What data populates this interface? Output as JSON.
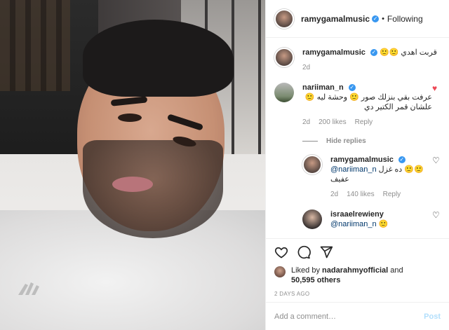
{
  "header": {
    "username": "ramygamalmusic",
    "follow_state": "Following",
    "separator": "•"
  },
  "caption": {
    "username": "ramygamalmusic",
    "text": "قربت اهدي 🙂🙂",
    "time": "2d"
  },
  "comments": [
    {
      "username": "nariiman_n",
      "text": "عرفت بقي بنزلك صور 🙂 وحشة ليه 🙂علشان قمر الكتير دي",
      "time": "2d",
      "likes": "200 likes",
      "reply_label": "Reply",
      "liked": true
    }
  ],
  "hide_replies": "Hide replies",
  "replies": [
    {
      "username": "ramygamalmusic",
      "mention": "@nariiman_n",
      "text": "🙂🙂 ده غزل عفيف",
      "time": "2d",
      "likes": "140 likes",
      "reply_label": "Reply"
    },
    {
      "username": "israaelrewieny",
      "mention": "@nariiman_n",
      "text": "🙂"
    }
  ],
  "likes": {
    "prefix": "Liked by",
    "user": "nadarahmyofficial",
    "and": "and",
    "others": "50,595 others"
  },
  "post_date": "2 DAYS AGO",
  "add_comment": {
    "placeholder": "Add a comment…",
    "post": "Post"
  },
  "colors": {
    "verified": "#3897f0",
    "heart": "#ed4956",
    "post_disabled": "#b2dffc"
  }
}
